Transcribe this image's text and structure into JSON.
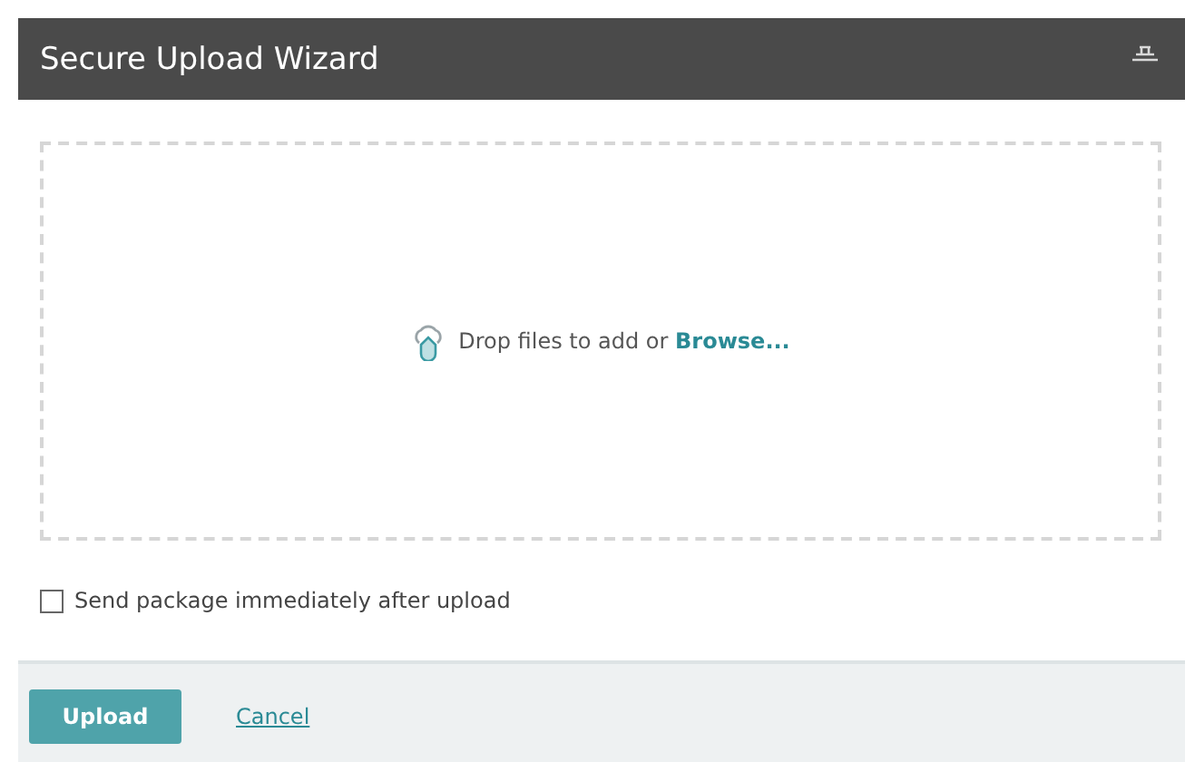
{
  "window": {
    "title": "Secure Upload Wizard"
  },
  "drop_zone": {
    "hint": "Drop files to add or",
    "link": "Browse..."
  },
  "options": [
    {
      "label": "Send package immediately after upload",
      "checked": false
    }
  ],
  "buttons": [
    {
      "label": "Upload",
      "kind": "primary"
    },
    {
      "label": "Cancel",
      "kind": "link"
    }
  ]
}
